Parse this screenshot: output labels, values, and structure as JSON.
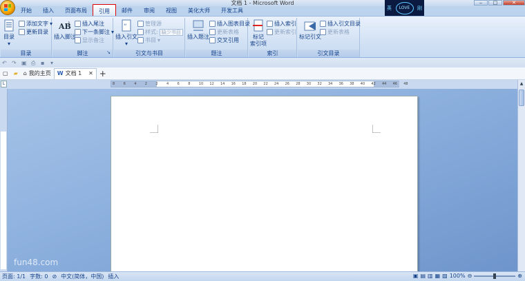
{
  "window": {
    "title": "文档 1 - Microsoft Word"
  },
  "love_logo": {
    "left": "英",
    "mid": "LOVE",
    "right": "刚"
  },
  "ribbon_tabs": [
    {
      "label": "开始"
    },
    {
      "label": "插入"
    },
    {
      "label": "页面布局"
    },
    {
      "label": "引用"
    },
    {
      "label": "邮件"
    },
    {
      "label": "审阅"
    },
    {
      "label": "视图"
    },
    {
      "label": "美化大师"
    },
    {
      "label": "开发工具"
    }
  ],
  "active_tab": "引用",
  "groups": {
    "toc": {
      "label": "目录",
      "toc": "目录",
      "add_text": "添加文字",
      "update_toc": "更新目录"
    },
    "footnote": {
      "label": "脚注",
      "insert_footnote_1": "插入脚注",
      "insert_endnote": "插入尾注",
      "next_footnote": "下一条脚注",
      "show_notes": "显示备注"
    },
    "citation": {
      "label": "引文与书目",
      "insert_citation": "插入引文",
      "manage_sources": "管理源",
      "style": "样式:",
      "style_value": "缺少书目",
      "bibliography": "书目"
    },
    "caption": {
      "label": "题注",
      "insert_caption": "插入题注",
      "insert_toc_fig": "插入图表目录",
      "update_table": "更新表格",
      "cross_ref": "交叉引用"
    },
    "index": {
      "label": "索引",
      "mark_entry": "标记\n索引项",
      "insert_index": "插入索引",
      "update_index": "更新索引"
    },
    "toa": {
      "label": "引文目录",
      "mark_citation": "标记引文",
      "insert_toa": "插入引文目录",
      "update_table": "更新表格"
    }
  },
  "doc_tabs": [
    {
      "label": "我的主页"
    },
    {
      "label": "文档 1"
    }
  ],
  "ruler_numbers": [
    "8",
    "6",
    "4",
    "2",
    "2",
    "4",
    "6",
    "8",
    "10",
    "12",
    "14",
    "16",
    "18",
    "20",
    "22",
    "24",
    "26",
    "28",
    "30",
    "32",
    "34",
    "36",
    "38",
    "40",
    "42",
    "44",
    "46",
    "48"
  ],
  "status": {
    "page": "页面: 1/1",
    "words": "字数: 0",
    "lang": "中文(简体，中国)",
    "insert": "插入",
    "zoom": "100%"
  },
  "watermark": "fun48.com"
}
